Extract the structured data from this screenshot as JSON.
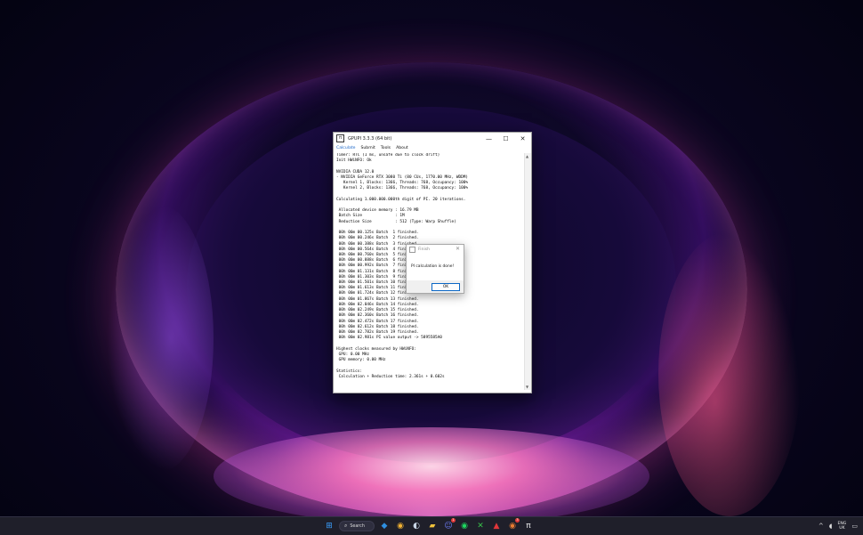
{
  "window": {
    "title": "GPUPI 3.3.3 (64 bit)",
    "app_icon_glyph": "π",
    "controls": {
      "minimize": "—",
      "maximize": "☐",
      "close": "✕"
    }
  },
  "menu": [
    "Calculate",
    "Submit",
    "Tools",
    "About"
  ],
  "console_lines": [
    "Timer: RTC (1 ms, unsafe due to clock drift)",
    "Init HWiNFO: Ok",
    "",
    "NVIDIA CUDA 12.0",
    "- NVIDIA GeForce RTX 3080 Ti (80 CUs, 1770.00 MHz, WDDM)",
    "   Kernel 1, Blocks: 1366, Threads: 768, Occupancy: 100%",
    "   Kernel 2, Blocks: 1366, Threads: 768, Occupancy: 100%",
    "",
    "Calculating 1.000.000.000th digit of PI. 20 iterations.",
    "",
    " Allocated device memory : 16.79 MB",
    " Batch Size              : 1M",
    " Reduction Size          : 512 (Type: Warp Shuffle)",
    "",
    " 00h 00m 00.125s Batch  1 finished.",
    " 00h 00m 00.246s Batch  2 finished.",
    " 00h 00m 00.388s Batch  3 finished.",
    " 00h 00m 00.564s Batch  4 finished.",
    " 00h 00m 00.760s Batch  5 finished.",
    " 00h 00m 00.888s Batch  6 finished.",
    " 00h 00m 00.992s Batch  7 finished.",
    " 00h 00m 01.131s Batch  8 finished.",
    " 00h 00m 01.303s Batch  9 finished.",
    " 00h 00m 01.501s Batch 10 finished.",
    " 00h 00m 01.613s Batch 11 finished.",
    " 00h 00m 01.724s Batch 12 finished.",
    " 00h 00m 01.867s Batch 13 finished.",
    " 00h 00m 02.046s Batch 14 finished.",
    " 00h 00m 02.249s Batch 15 finished.",
    " 00h 00m 02.360s Batch 16 finished.",
    " 00h 00m 02.472s Batch 17 finished.",
    " 00h 00m 02.612s Batch 18 finished.",
    " 00h 00m 02.782s Batch 19 finished.",
    " 00h 00m 02.981s PI value output -> 5895585A0",
    "",
    "Highest clocks measured by HWiNFO:",
    " GPU: 0.00 MHz",
    " GPU memory: 0.00 MHz",
    "",
    "Statistics:",
    " Calculation + Reduction time: 2.361s + 0.602s"
  ],
  "dialog": {
    "title": "Finish",
    "message": "PI calculation is done!",
    "ok_label": "OK",
    "close_glyph": "✕"
  },
  "taskbar": {
    "search_label": "Search",
    "apps": [
      {
        "name": "start-icon",
        "glyph": "⊞",
        "color": "#3aa0ff"
      },
      {
        "name": "vscode-icon",
        "glyph": "◆",
        "color": "#2f8fe0"
      },
      {
        "name": "chrome-icon",
        "glyph": "◉",
        "color": "#f2b233"
      },
      {
        "name": "steam-icon",
        "glyph": "◐",
        "color": "#c9d6e6"
      },
      {
        "name": "file-explorer-icon",
        "glyph": "▰",
        "color": "#f0c23b"
      },
      {
        "name": "discord-icon",
        "glyph": "☺",
        "color": "#6d7cf5",
        "badge": "1"
      },
      {
        "name": "spotify-icon",
        "glyph": "◉",
        "color": "#1ed760"
      },
      {
        "name": "xbox-icon",
        "glyph": "✕",
        "color": "#38c04a"
      },
      {
        "name": "app-red-icon",
        "glyph": "▲",
        "color": "#e0363a"
      },
      {
        "name": "chrome-2-icon",
        "glyph": "◉",
        "color": "#e87b32",
        "badge": "3"
      },
      {
        "name": "gpupi-taskbar-icon",
        "glyph": "π",
        "color": "#e8e8e8"
      }
    ],
    "tray": {
      "chevron": "^",
      "volume": "◖",
      "lang_top": "ENG",
      "lang_bottom": "UK",
      "notification": "▭"
    }
  }
}
